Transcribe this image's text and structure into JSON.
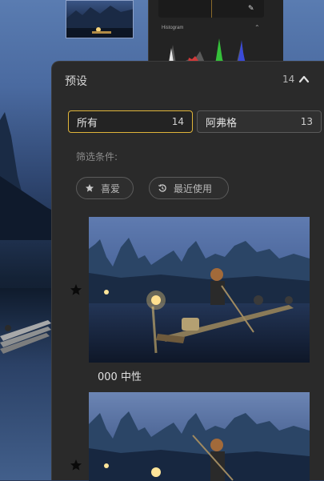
{
  "histogram": {
    "title": "Histogram",
    "icons": {
      "pin": "pin-icon",
      "collapse": "chevron-up-icon"
    }
  },
  "panel": {
    "title": "预设",
    "count": "14",
    "collapse_icon": "chevron-up-icon"
  },
  "segments": [
    {
      "label": "所有",
      "count": "14",
      "selected": true
    },
    {
      "label": "阿弗格",
      "count": "13",
      "selected": false
    }
  ],
  "filter": {
    "label": "筛选条件:",
    "chips": [
      {
        "label": "喜爱",
        "icon": "star-icon"
      },
      {
        "label": "最近使用",
        "icon": "history-icon"
      }
    ]
  },
  "presets": [
    {
      "name": "000 中性",
      "favorite": true
    },
    {
      "name": "",
      "favorite": true
    }
  ],
  "colors": {
    "accent": "#e0b53a",
    "panel_bg": "#2a2a2a"
  }
}
